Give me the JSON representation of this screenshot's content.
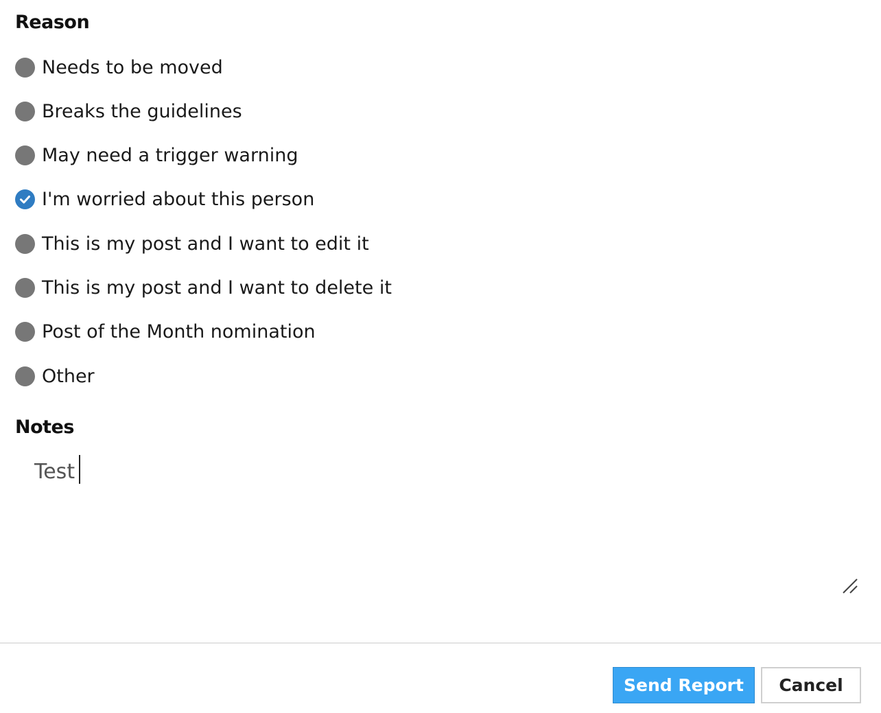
{
  "reason": {
    "title": "Reason",
    "options": [
      {
        "label": "Needs to be moved",
        "checked": false
      },
      {
        "label": "Breaks the guidelines",
        "checked": false
      },
      {
        "label": "May need a trigger warning",
        "checked": false
      },
      {
        "label": "I'm worried about this person",
        "checked": true
      },
      {
        "label": "This is my post and I want to edit it",
        "checked": false
      },
      {
        "label": "This is my post and I want to delete it",
        "checked": false
      },
      {
        "label": "Post of the Month nomination",
        "checked": false
      },
      {
        "label": "Other",
        "checked": false
      }
    ]
  },
  "notes": {
    "title": "Notes",
    "value": "Test"
  },
  "footer": {
    "send_label": "Send Report",
    "cancel_label": "Cancel"
  },
  "colors": {
    "radio_unchecked": "#777777",
    "radio_checked": "#2f7cc2",
    "primary_button": "#3aa6f4"
  }
}
